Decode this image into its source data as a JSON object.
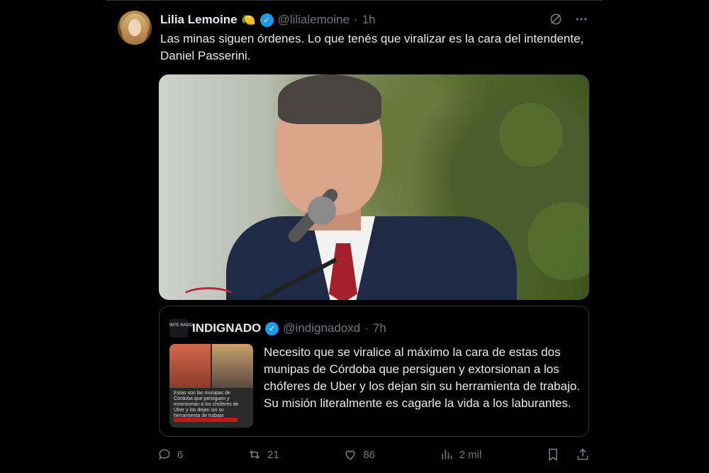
{
  "tweet": {
    "author_name": "Lilia Lemoine",
    "name_emoji": "🍋",
    "handle": "@lilialemoine",
    "separator": "·",
    "time": "1h",
    "text": "Las minas siguen órdenes. Lo que tenés que viralizar es la cara del intendente, Daniel Passerini."
  },
  "quoted": {
    "avatar_text": "INTE NADO",
    "author_name": "INDIGNADO",
    "handle": "@indignadoxd",
    "separator": "·",
    "time": "7h",
    "thumb_caption": "Estas son las munipas de Córdoba que persiguen y extorsionan a los chóferes de Uber y los dejan sin su herramienta de trabajo",
    "text": "Necesito que se viralice al máximo la cara de estas dos munipas de Córdoba que persiguen y extorsionan a los chóferes de Uber y los dejan sin su herramienta de trabajo. Su misión literalmente es cagarle la vida a los laburantes."
  },
  "metrics": {
    "replies": "6",
    "retweets": "21",
    "likes": "86",
    "views": "2 mil"
  },
  "colors": {
    "background": "#000000",
    "text": "#e7e9ea",
    "muted": "#71767b",
    "verified": "#1d9bf0",
    "border": "#2f3336"
  },
  "icons": {
    "verified": "verified-badge-icon",
    "grok": "grok-icon",
    "more": "more-icon",
    "reply": "reply-icon",
    "retweet": "retweet-icon",
    "like": "heart-icon",
    "views": "views-icon",
    "bookmark": "bookmark-icon",
    "share": "share-icon"
  }
}
